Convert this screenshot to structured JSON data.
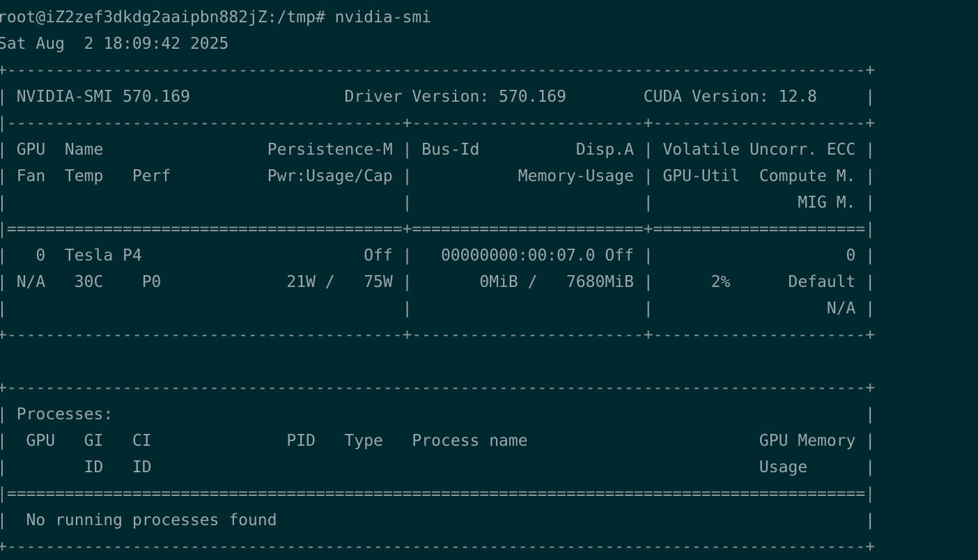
{
  "terminal": {
    "prompt": "root@iZ2zef3dkdg2aaipbn882jZ:/tmp# nvidia-smi",
    "timestamp": "Sat Aug  2 18:09:42 2025",
    "lines": [
      "+-----------------------------------------------------------------------------------------+",
      "| NVIDIA-SMI 570.169                Driver Version: 570.169        CUDA Version: 12.8     |",
      "|-----------------------------------------+------------------------+----------------------+",
      "| GPU  Name                 Persistence-M | Bus-Id          Disp.A | Volatile Uncorr. ECC |",
      "| Fan  Temp   Perf          Pwr:Usage/Cap |           Memory-Usage | GPU-Util  Compute M. |",
      "|                                         |                        |               MIG M. |",
      "|=========================================+========================+======================|",
      "|   0  Tesla P4                       Off |   00000000:00:07.0 Off |                    0 |",
      "| N/A   30C    P0             21W /   75W |       0MiB /   7680MiB |      2%      Default |",
      "|                                         |                        |                  N/A |",
      "+-----------------------------------------+------------------------+----------------------+",
      "",
      "+-----------------------------------------------------------------------------------------+",
      "| Processes:                                                                              |",
      "|  GPU   GI   CI              PID   Type   Process name                        GPU Memory |",
      "|        ID   ID                                                               Usage      |",
      "|=========================================================================================|",
      "|  No running processes found                                                             |",
      "+-----------------------------------------------------------------------------------------+"
    ]
  }
}
